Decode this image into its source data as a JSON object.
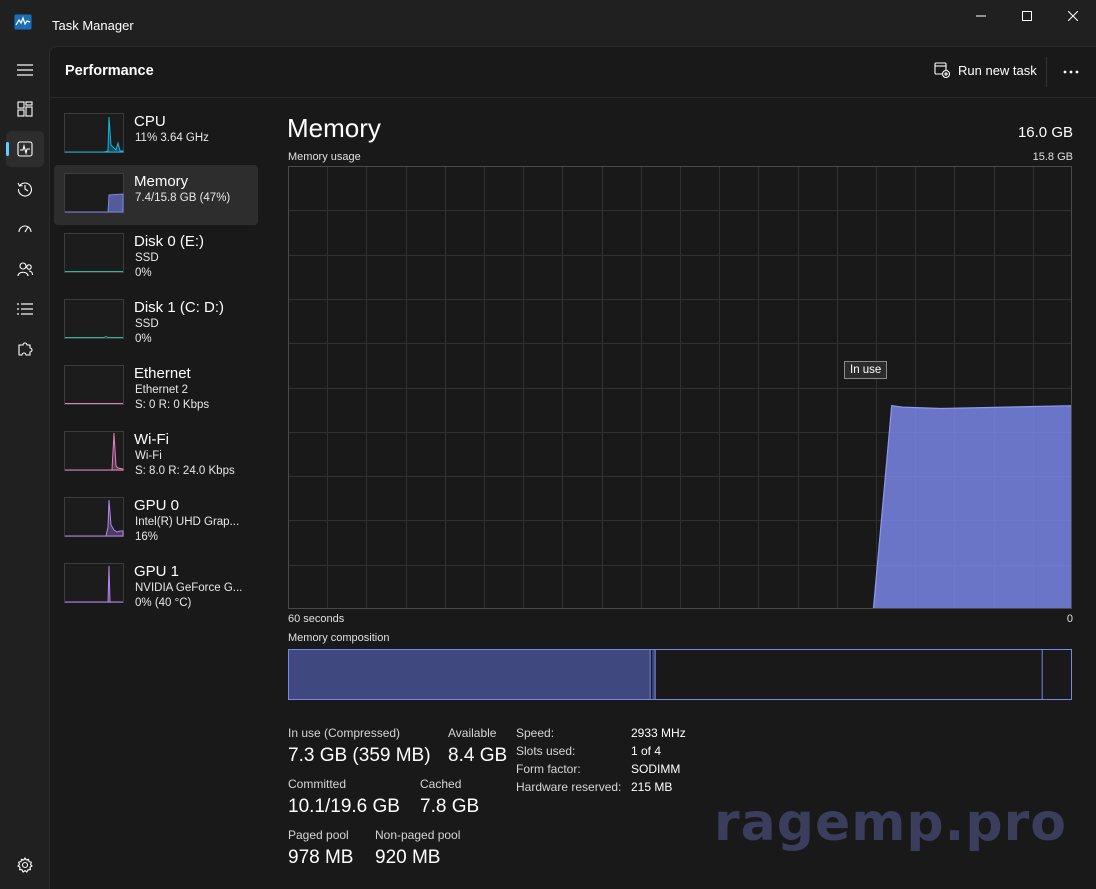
{
  "window": {
    "title": "Task Manager"
  },
  "nav": {
    "items": [
      "menu",
      "processes",
      "performance",
      "app-history",
      "startup-apps",
      "users",
      "details",
      "services"
    ],
    "active": "performance",
    "settings": "settings"
  },
  "header": {
    "title": "Performance",
    "run_new_task": "Run new task"
  },
  "devices": [
    {
      "name": "CPU",
      "line1": "11% 3.64 GHz",
      "line2": ""
    },
    {
      "name": "Memory",
      "line1": "7.4/15.8 GB (47%)",
      "line2": ""
    },
    {
      "name": "Disk 0 (E:)",
      "line1": "SSD",
      "line2": "0%"
    },
    {
      "name": "Disk 1 (C: D:)",
      "line1": "SSD",
      "line2": "0%"
    },
    {
      "name": "Ethernet",
      "line1": "Ethernet 2",
      "line2": "S: 0 R: 0 Kbps"
    },
    {
      "name": "Wi-Fi",
      "line1": "Wi-Fi",
      "line2": "S: 8.0 R: 24.0 Kbps"
    },
    {
      "name": "GPU 0",
      "line1": "Intel(R) UHD Grap...",
      "line2": "16%"
    },
    {
      "name": "GPU 1",
      "line1": "NVIDIA GeForce G...",
      "line2": "0% (40 °C)"
    }
  ],
  "memory": {
    "title": "Memory",
    "total": "16.0 GB",
    "usage_label": "Memory usage",
    "usage_max": "15.8 GB",
    "x_left": "60 seconds",
    "x_right": "0",
    "tooltip": "In use",
    "composition_label": "Memory composition",
    "composition": {
      "in_use": 7.3,
      "modified": 0.1,
      "standby": 7.8,
      "free": 0.6
    },
    "stats": {
      "in_use_label": "In use (Compressed)",
      "in_use_value": "7.3 GB (359 MB)",
      "available_label": "Available",
      "available_value": "8.4 GB",
      "committed_label": "Committed",
      "committed_value": "10.1/19.6 GB",
      "cached_label": "Cached",
      "cached_value": "7.8 GB",
      "paged_label": "Paged pool",
      "paged_value": "978 MB",
      "nonpaged_label": "Non-paged pool",
      "nonpaged_value": "920 MB"
    },
    "specs": [
      {
        "key": "Speed:",
        "value": "2933 MHz"
      },
      {
        "key": "Slots used:",
        "value": "1 of 4"
      },
      {
        "key": "Form factor:",
        "value": "SODIMM"
      },
      {
        "key": "Hardware reserved:",
        "value": "215 MB"
      }
    ]
  },
  "chart_data": {
    "type": "area",
    "ylabel": "Memory usage",
    "xlim": [
      60,
      0
    ],
    "ylim": [
      0,
      15.8
    ],
    "x": [
      60,
      15.2,
      13.8,
      13,
      10,
      5,
      0
    ],
    "values": [
      0,
      0,
      7.25,
      7.2,
      7.15,
      7.2,
      7.25
    ],
    "grid": true
  },
  "watermark": "ragemp.pro",
  "colors": {
    "memory": "#7a86e8",
    "cpu": "#17b4e5",
    "disk": "#2fb596",
    "network": "#e17fbd",
    "gpu": "#b983f7",
    "accent": "#60cdff"
  }
}
